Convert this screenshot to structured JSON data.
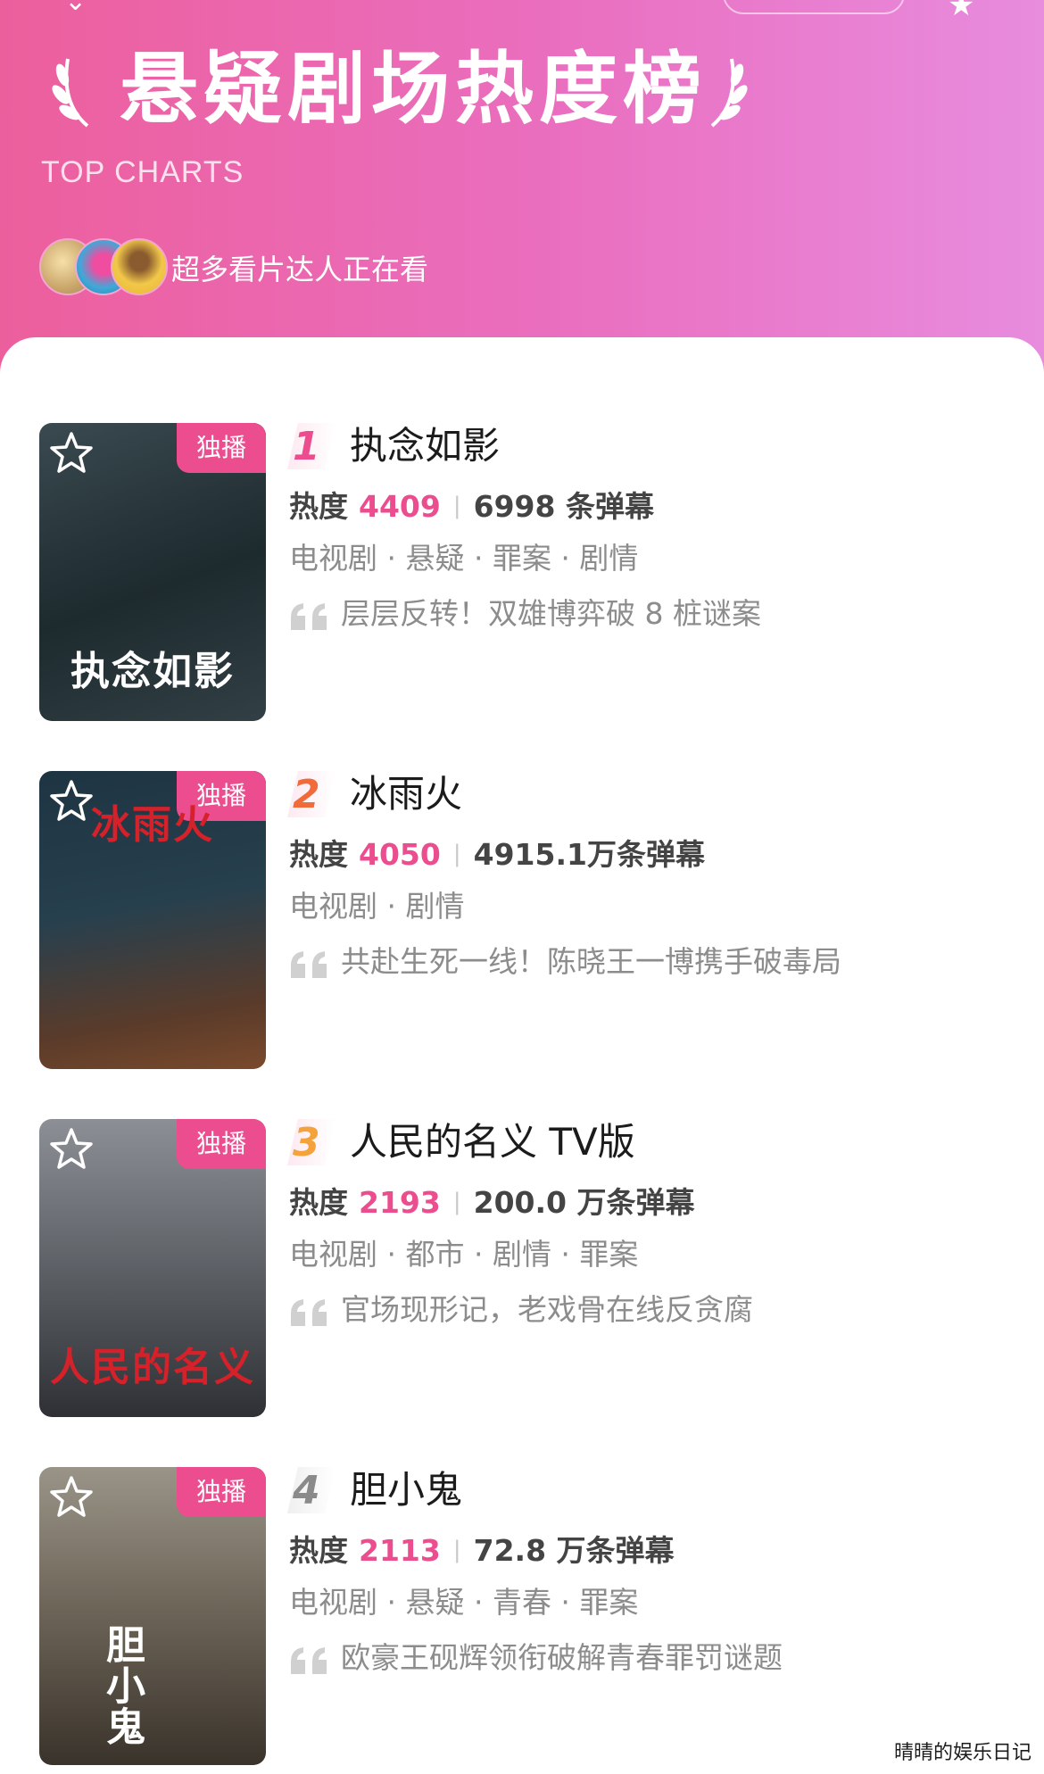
{
  "header": {
    "title": "悬疑剧场热度榜",
    "subtitle": "TOP CHARTS",
    "viewers_text": "超多看片达人正在看",
    "gradient_colors": [
      "#ec5f9d",
      "#e88cde"
    ]
  },
  "items": [
    {
      "rank": "1",
      "title": "执念如影",
      "badge": "独播",
      "heat_label": "热度",
      "heat_value": "4409",
      "danmaku": "6998 条弹幕",
      "tags": "电视剧 · 悬疑 · 罪案 · 剧情",
      "quote": "层层反转！双雄博弈破 8 桩谜案",
      "poster_title": "执念如影"
    },
    {
      "rank": "2",
      "title": "冰雨火",
      "badge": "独播",
      "heat_label": "热度",
      "heat_value": "4050",
      "danmaku": "4915.1万条弹幕",
      "tags": "电视剧 · 剧情",
      "quote": "共赴生死一线！陈晓王一博携手破毒局",
      "poster_title": "冰雨火"
    },
    {
      "rank": "3",
      "title": "人民的名义 TV版",
      "badge": "独播",
      "heat_label": "热度",
      "heat_value": "2193",
      "danmaku": "200.0 万条弹幕",
      "tags": "电视剧 · 都市 · 剧情 · 罪案",
      "quote": "官场现形记，老戏骨在线反贪腐",
      "poster_title": "人民的名义"
    },
    {
      "rank": "4",
      "title": "胆小鬼",
      "badge": "独播",
      "heat_label": "热度",
      "heat_value": "2113",
      "danmaku": "72.8 万条弹幕",
      "tags": "电视剧 · 悬疑 · 青春 · 罪案",
      "quote": "欧豪王砚辉领衔破解青春罪罚谜题",
      "poster_title": "胆小鬼"
    }
  ],
  "watermark": "晴晴的娱乐日记",
  "colors": {
    "accent": "#ec4d8e",
    "rank2": "#f06a3a",
    "rank3": "#f4a23b",
    "rank4": "#8a8a8a"
  }
}
